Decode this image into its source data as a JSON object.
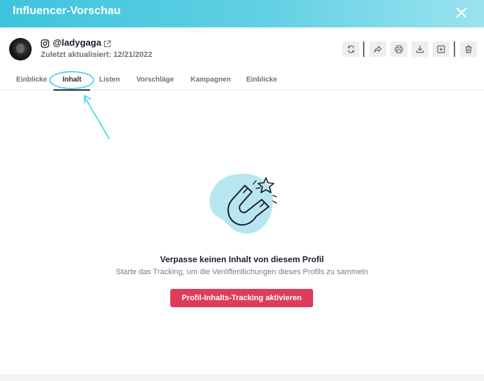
{
  "header": {
    "title": "Influencer-Vorschau",
    "close_icon": "close-icon",
    "background_start": "#3cc4dc",
    "background_end": "#9be3ee"
  },
  "profile": {
    "platform_icon": "instagram-icon",
    "handle": "@ladygaga",
    "external_link_icon": "external-link-icon",
    "last_updated": "Zuletzt aktualisiert: 12/21/2022"
  },
  "toolbar": {
    "buttons": [
      {
        "name": "refresh",
        "icon": "refresh-icon"
      },
      {
        "name": "share",
        "icon": "share-icon"
      },
      {
        "name": "print",
        "icon": "print-icon"
      },
      {
        "name": "download",
        "icon": "download-icon"
      },
      {
        "name": "add",
        "icon": "plus-square-icon"
      },
      {
        "name": "delete",
        "icon": "trash-icon"
      }
    ]
  },
  "tabs": [
    {
      "label": "Einblicke",
      "active": false
    },
    {
      "label": "Inhalt",
      "active": true
    },
    {
      "label": "Listen",
      "active": false
    },
    {
      "label": "Vorschläge",
      "active": false
    },
    {
      "label": "Kampagnen",
      "active": false
    },
    {
      "label": "Einblicke",
      "active": false
    }
  ],
  "empty_state": {
    "illustration_icon": "magnet-star-icon",
    "title": "Verpasse keinen Inhalt von diesem Profil",
    "subtitle": "Starte das Tracking, um die Veröffentlichungen dieses Profils zu sammeln",
    "cta_label": "Profil-Inhalts-Tracking aktivieren"
  },
  "colors": {
    "accent_cta": "#e13b5b",
    "highlight": "#56d8ea",
    "illustration_blob": "#b8e6f0"
  }
}
